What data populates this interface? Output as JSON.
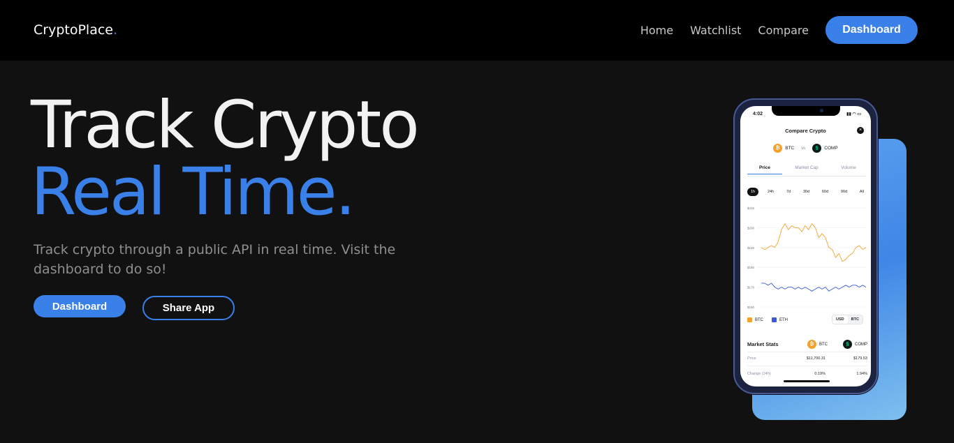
{
  "brand": {
    "name": "CryptoPlace",
    "dot": "."
  },
  "nav": {
    "home": "Home",
    "watchlist": "Watchlist",
    "compare": "Compare",
    "dashboard": "Dashboard"
  },
  "hero": {
    "line1": "Track Crypto",
    "line2": "Real Time.",
    "subtitle": "Track crypto through a public API in real time. Visit the dashboard to do so!",
    "primary_button": "Dashboard",
    "secondary_button": "Share App"
  },
  "colors": {
    "accent": "#3a80e9",
    "btc": "#f4a12e",
    "eth": "#3b5bdb"
  },
  "phone": {
    "time": "4:02",
    "title": "Compare Crypto",
    "coin_a": "BTC",
    "vs": "vs",
    "coin_b": "COMP",
    "tabs": [
      "Price",
      "Market Cap",
      "Volume"
    ],
    "ranges": [
      "1h",
      "24h",
      "7d",
      "30d",
      "60d",
      "90d",
      "All"
    ],
    "y_labels": [
      "$210",
      "$200",
      "$190",
      "$180",
      "$170",
      "$160"
    ],
    "legend": [
      "BTC",
      "ETH"
    ],
    "currency": [
      "USD",
      "BTC"
    ],
    "stats_title": "Market Stats",
    "stats_coin_a": "BTC",
    "stats_coin_b": "COMP",
    "rows": [
      {
        "label": "Price",
        "a": "$11,700.31",
        "b": "$179.53"
      },
      {
        "label": "Change (24h)",
        "a": "0.19%",
        "b": "1.94%"
      }
    ]
  },
  "chart_data": {
    "type": "line",
    "ylim": [
      160,
      210
    ],
    "series": [
      {
        "name": "BTC",
        "values": [
          190,
          189,
          190,
          191,
          190,
          193,
          199,
          202,
          199,
          201,
          200,
          200,
          198,
          201,
          199,
          202,
          200,
          195,
          197,
          195,
          190,
          189,
          185,
          187,
          183,
          184,
          186,
          187,
          190,
          191,
          189,
          190
        ]
      },
      {
        "name": "ETH",
        "values": [
          172,
          172,
          171,
          172,
          170,
          169,
          170,
          169,
          170,
          170,
          169,
          170,
          169,
          170,
          169,
          168,
          169,
          170,
          169,
          170,
          168,
          169,
          170,
          169,
          170,
          171,
          170,
          171,
          171,
          170,
          171,
          170
        ]
      }
    ]
  }
}
